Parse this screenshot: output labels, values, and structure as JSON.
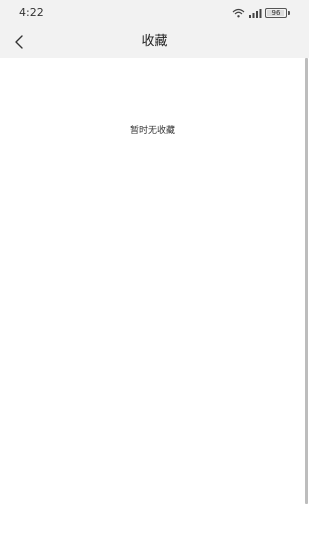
{
  "status_bar": {
    "time": "4:22",
    "battery_level": 96,
    "battery_text": "96",
    "icons": [
      "wifi-icon",
      "signal-icon",
      "battery-icon"
    ]
  },
  "nav": {
    "back_icon": "chevron-left-icon",
    "title": "收藏"
  },
  "content": {
    "empty_message": "暂时无收藏"
  },
  "colors": {
    "header_background": "#f2f2f2",
    "page_background": "#ffffff",
    "scrollbar": "#bdbdbd"
  }
}
